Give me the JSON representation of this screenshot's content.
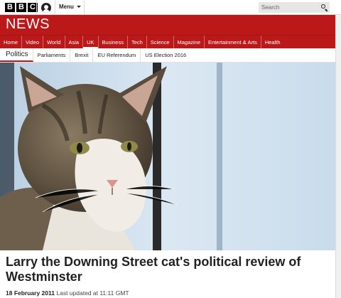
{
  "topbar": {
    "logo_letters": [
      "B",
      "B",
      "C"
    ],
    "menu_label": "Menu",
    "search_placeholder": "Search"
  },
  "banner": {
    "title": "NEWS",
    "color": "#bb1919"
  },
  "main_nav": [
    {
      "label": "Home"
    },
    {
      "label": "Video"
    },
    {
      "label": "World"
    },
    {
      "label": "Asia"
    },
    {
      "label": "UK"
    },
    {
      "label": "Business"
    },
    {
      "label": "Tech"
    },
    {
      "label": "Science"
    },
    {
      "label": "Magazine"
    },
    {
      "label": "Entertainment & Arts"
    },
    {
      "label": "Health"
    }
  ],
  "sub_nav": {
    "section": "Politics",
    "items": [
      {
        "label": "Parliaments"
      },
      {
        "label": "Brexit"
      },
      {
        "label": "EU Referendum"
      },
      {
        "label": "US Election 2016"
      }
    ]
  },
  "article": {
    "headline": "Larry the Downing Street cat's political review of Westminster",
    "date": "18 February 2011",
    "updated": "Last updated at 11:11 GMT"
  }
}
